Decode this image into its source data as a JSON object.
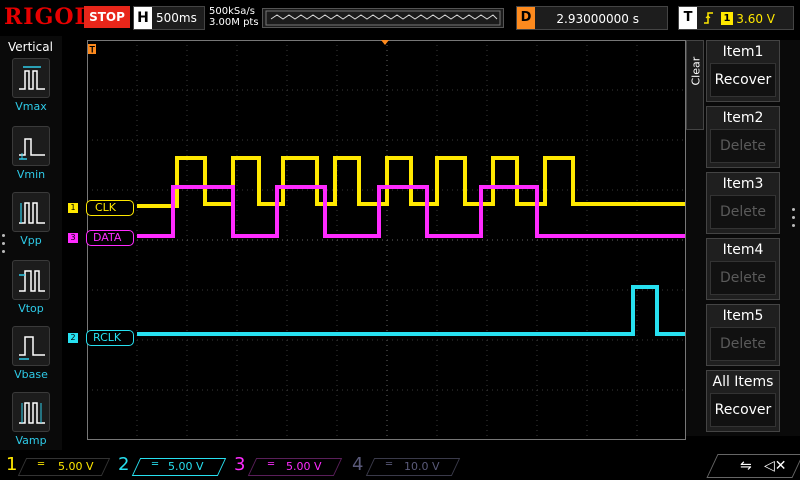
{
  "topbar": {
    "logo": "RIGOL",
    "run_state": "STOP",
    "timebase_label": "H",
    "timebase_value": "500ms",
    "sample_rate": "500kSa/s",
    "mem_depth": "3.00M pts",
    "delay_label": "D",
    "delay_value": "2.93000000 s",
    "trigger_label": "T",
    "trigger_edge": "rising-edge-icon",
    "trigger_source": "1",
    "trigger_level": "3.60 V"
  },
  "left_panel": {
    "title": "Vertical",
    "measurements": [
      {
        "label": "Vmax",
        "icon": "vmax-icon"
      },
      {
        "label": "Vmin",
        "icon": "vmin-icon"
      },
      {
        "label": "Vpp",
        "icon": "vpp-icon"
      },
      {
        "label": "Vtop",
        "icon": "vtop-icon"
      },
      {
        "label": "Vbase",
        "icon": "vbase-icon"
      },
      {
        "label": "Vamp",
        "icon": "vamp-icon"
      }
    ]
  },
  "waveforms": {
    "trigger_marker": "T",
    "channels": [
      {
        "num": "1",
        "label": "CLK",
        "color": "#ffe800"
      },
      {
        "num": "3",
        "label": "DATA",
        "color": "#ff2bff"
      },
      {
        "num": "2",
        "label": "RCLK",
        "color": "#27e0f0"
      }
    ]
  },
  "right_panel": {
    "clear_label": "Clear",
    "items": [
      {
        "title": "Item1",
        "action": "Recover",
        "enabled": true
      },
      {
        "title": "Item2",
        "action": "Delete",
        "enabled": false
      },
      {
        "title": "Item3",
        "action": "Delete",
        "enabled": false
      },
      {
        "title": "Item4",
        "action": "Delete",
        "enabled": false
      },
      {
        "title": "Item5",
        "action": "Delete",
        "enabled": false
      },
      {
        "title": "All Items",
        "action": "Recover",
        "enabled": true
      }
    ]
  },
  "bottombar": {
    "channels": [
      {
        "num": "1",
        "scale": "5.00 V",
        "color": "#ffe800"
      },
      {
        "num": "2",
        "scale": "5.00 V",
        "color": "#27e0f0"
      },
      {
        "num": "3",
        "scale": "5.00 V",
        "color": "#ff2bff"
      },
      {
        "num": "4",
        "scale": "10.0 V",
        "color": "#5a5a7a"
      }
    ]
  }
}
